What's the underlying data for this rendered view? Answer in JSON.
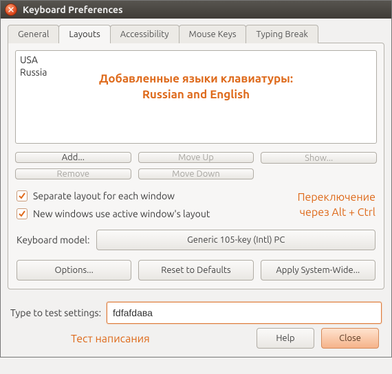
{
  "window": {
    "title": "Keyboard Preferences"
  },
  "tabs": {
    "general": "General",
    "layouts": "Layouts",
    "accessibility": "Accessibility",
    "mousekeys": "Mouse Keys",
    "typingbreak": "Typing Break"
  },
  "layouts_list": {
    "items": [
      "USA",
      "Russia"
    ],
    "overlay_line1": "Добавленные языки клавиатуры:",
    "overlay_line2": "Russian and English"
  },
  "buttons": {
    "add": "Add...",
    "remove": "Remove",
    "moveup": "Move Up",
    "movedown": "Move Down",
    "show": "Show...",
    "options": "Options...",
    "reset": "Reset to Defaults",
    "apply": "Apply System-Wide..."
  },
  "checks": {
    "separate": "Separate layout for each window",
    "newwin": "New windows use active window's layout"
  },
  "switch_note": {
    "line1": "Переключение",
    "line2": "через Alt + Ctrl"
  },
  "keyboard_model": {
    "label": "Keyboard model:",
    "value": "Generic 105-key (Intl) PC"
  },
  "test": {
    "label": "Type to test settings:",
    "value": "fdfafdaва",
    "caption": "Тест написания"
  },
  "dialog": {
    "help": "Help",
    "close": "Close"
  }
}
